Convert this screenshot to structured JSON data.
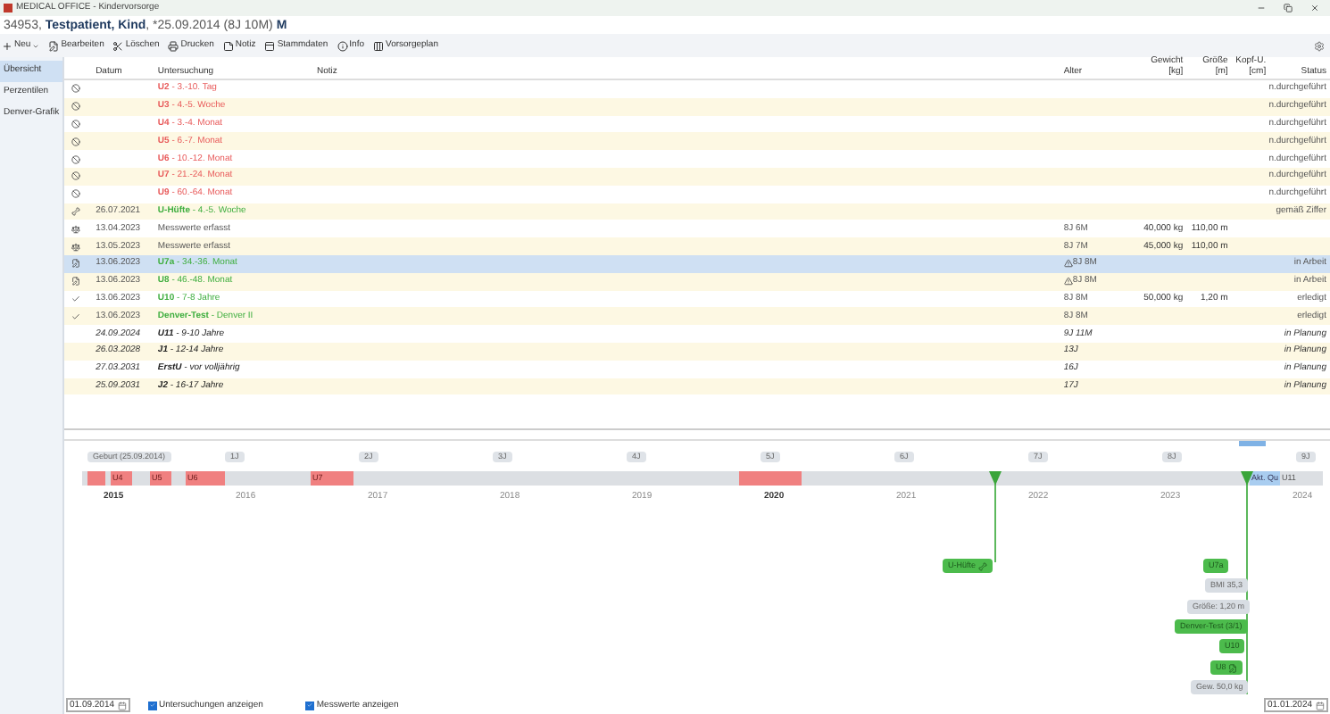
{
  "window": {
    "title": "MEDICAL OFFICE - Kindervorsorge"
  },
  "patient": {
    "id": "34953,",
    "name": "Testpatient, Kind",
    "birth": ", *25.09.2014 (8J 10M)",
    "sex": "M"
  },
  "toolbar": [
    {
      "label": "Neu",
      "kind": "new"
    },
    {
      "label": "Bearbeiten",
      "kind": "edit"
    },
    {
      "label": "Löschen",
      "kind": "delete"
    },
    {
      "label": "Drucken",
      "kind": "print"
    },
    {
      "label": "Notiz",
      "kind": "note"
    },
    {
      "label": "Stammdaten",
      "kind": "master"
    },
    {
      "label": "Info",
      "kind": "info"
    },
    {
      "label": "Vorsorgeplan",
      "kind": "plan"
    }
  ],
  "sidebar": {
    "items": [
      {
        "label": "Übersicht",
        "selected": true
      },
      {
        "label": "Perzentilen",
        "selected": false
      },
      {
        "label": "Denver-Grafik",
        "selected": false
      }
    ]
  },
  "table": {
    "columns": [
      {
        "label": "Datum"
      },
      {
        "label": "Untersuchung"
      },
      {
        "label": "Notiz"
      },
      {
        "label": "Alter"
      },
      {
        "label": "Gewicht",
        "unit": "[kg]"
      },
      {
        "label": "Größe",
        "unit": "[m]"
      },
      {
        "label": "Kopf-U.",
        "unit": "[cm]"
      },
      {
        "label": "Status"
      }
    ],
    "rows": [
      {
        "kind": "missed",
        "code": "U2",
        "range": " - 3.-10. Tag",
        "status": "n.durchgeführt",
        "selected": false
      },
      {
        "kind": "missed",
        "code": "U3",
        "range": " - 4.-5. Woche",
        "status": "n.durchgeführt",
        "selected": false
      },
      {
        "kind": "missed",
        "code": "U4",
        "range": " - 3.-4. Monat",
        "status": "n.durchgeführt",
        "selected": false
      },
      {
        "kind": "missed",
        "code": "U5",
        "range": " - 6.-7. Monat",
        "status": "n.durchgeführt",
        "selected": false
      },
      {
        "kind": "missed",
        "code": "U6",
        "range": " - 10.-12. Monat",
        "status": "n.durchgeführt",
        "selected": false
      },
      {
        "kind": "missed",
        "code": "U7",
        "range": " - 21.-24. Monat",
        "status": "n.durchgeführt",
        "selected": false
      },
      {
        "kind": "missed",
        "code": "U9",
        "range": " - 60.-64. Monat",
        "status": "n.durchgeführt",
        "selected": false
      },
      {
        "kind": "hip",
        "date": "26.07.2021",
        "code": "U-Hüfte",
        "range": " - 4.-5. Woche",
        "status": "gemäß Ziffer",
        "selected": false
      },
      {
        "kind": "scale",
        "date": "13.04.2023",
        "range": "Messwerte erfasst",
        "age": "8J 6M",
        "warning": false,
        "weight": "40,000 kg",
        "height": "110,00 m",
        "selected": false
      },
      {
        "kind": "scale",
        "date": "13.05.2023",
        "range": "Messwerte erfasst",
        "age": "8J 7M",
        "warning": false,
        "weight": "45,000 kg",
        "height": "110,00 m",
        "selected": false
      },
      {
        "kind": "note",
        "date": "13.06.2023",
        "code": "U7a",
        "range": " - 34.-36. Monat",
        "age": "8J 8M",
        "warning": true,
        "status": "in Arbeit",
        "selected": true
      },
      {
        "kind": "note",
        "date": "13.06.2023",
        "code": "U8",
        "range": " - 46.-48. Monat",
        "age": "8J 8M",
        "warning": true,
        "status": "in Arbeit",
        "selected": false
      },
      {
        "kind": "check",
        "date": "13.06.2023",
        "code": "U10",
        "range": " - 7-8 Jahre",
        "age": "8J 8M",
        "warning": false,
        "weight": "50,000 kg",
        "height": "1,20 m",
        "status": "erledigt",
        "selected": false
      },
      {
        "kind": "check",
        "date": "13.06.2023",
        "code": "Denver-Test",
        "range": " - Denver II",
        "age": "8J 8M",
        "warning": false,
        "status": "erledigt",
        "selected": false
      },
      {
        "kind": "planned",
        "date": "24.09.2024",
        "code": "U11",
        "range": " - 9-10 Jahre",
        "age": "9J 11M",
        "warning": false,
        "status": "in Planung",
        "selected": false
      },
      {
        "kind": "planned",
        "date": "26.03.2028",
        "code": "J1",
        "range": " - 12-14 Jahre",
        "age": "13J",
        "warning": false,
        "status": "in Planung",
        "selected": false
      },
      {
        "kind": "planned",
        "date": "27.03.2031",
        "code": "ErstU",
        "range": " - vor volljährig",
        "age": "16J",
        "warning": false,
        "status": "in Planung",
        "selected": false
      },
      {
        "kind": "planned",
        "date": "25.09.2031",
        "code": "J2",
        "range": " - 16-17 Jahre",
        "age": "17J",
        "warning": false,
        "status": "in Planung",
        "selected": false
      }
    ]
  },
  "timeline": {
    "ages": [
      "Geburt (25.09.2014)",
      "1J",
      "2J",
      "3J",
      "4J",
      "5J",
      "6J",
      "7J",
      "8J",
      "9J"
    ],
    "years": [
      {
        "label": "2015",
        "bold": true
      },
      {
        "label": "2016",
        "bold": false
      },
      {
        "label": "2017",
        "bold": false
      },
      {
        "label": "2018",
        "bold": false
      },
      {
        "label": "2019",
        "bold": false
      },
      {
        "label": "2020",
        "bold": true
      },
      {
        "label": "2021",
        "bold": false
      },
      {
        "label": "2022",
        "bold": false
      },
      {
        "label": "2023",
        "bold": false
      },
      {
        "label": "2024",
        "bold": false
      }
    ],
    "segments": [
      "U4",
      "U5",
      "U6",
      "U7"
    ],
    "current": "Akt. Qu",
    "next": "U11",
    "events": [
      {
        "label": "U-Hüfte",
        "kind": "hip"
      },
      {
        "label": "U7a",
        "kind": "exam"
      },
      {
        "label": "BMI 35,3",
        "kind": "value"
      },
      {
        "label": "Größe: 1,20 m",
        "kind": "value"
      },
      {
        "label": "Denver-Test (3/1)",
        "kind": "exam"
      },
      {
        "label": "U10",
        "kind": "exam"
      },
      {
        "label": "U8",
        "kind": "note"
      },
      {
        "label": "Gew. 50,0 kg",
        "kind": "value"
      }
    ]
  },
  "footer": {
    "start_date": "01.09.2014",
    "checkboxes": [
      {
        "label": "Untersuchungen anzeigen",
        "checked": true
      },
      {
        "label": "Messwerte anzeigen",
        "checked": true
      }
    ],
    "end_date": "01.01.2024"
  }
}
